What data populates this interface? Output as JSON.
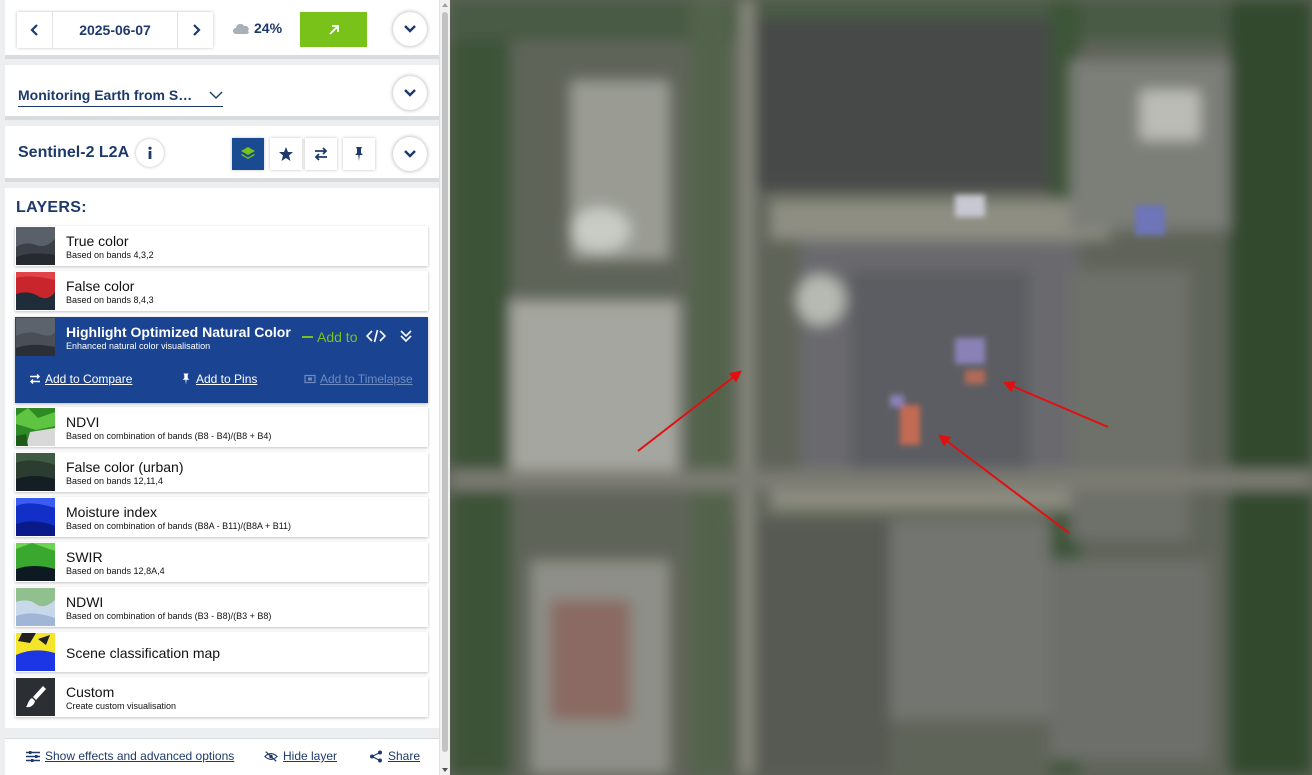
{
  "date_bar": {
    "date": "2025-06-07",
    "cloud_coverage": "24%",
    "prev_icon": "chevron-left-icon",
    "next_icon": "chevron-right-icon",
    "cloud_icon": "cloud-icon",
    "go_icon": "arrow-up-right-icon",
    "accent_color": "#78c21a"
  },
  "theme": {
    "selected": "Monitoring Earth from S…"
  },
  "dataset": {
    "title": "Sentinel-2 L2A",
    "tabs": [
      "layers-icon",
      "star-icon",
      "compare-icon",
      "pin-icon"
    ],
    "active_tab": "layers-icon",
    "brand_color": "#1a4491"
  },
  "layers": {
    "heading": "LAYERS:",
    "items": [
      {
        "title": "True color",
        "description": "Based on bands 4,3,2"
      },
      {
        "title": "False color",
        "description": "Based on bands 8,4,3"
      },
      {
        "title": "Highlight Optimized Natural Color",
        "description": "Enhanced natural color visualisation",
        "selected": true
      },
      {
        "title": "NDVI",
        "description": "Based on combination of bands (B8 - B4)/(B8 + B4)"
      },
      {
        "title": "False color (urban)",
        "description": "Based on bands 12,11,4"
      },
      {
        "title": "Moisture index",
        "description": "Based on combination of bands (B8A - B11)/(B8A + B11)"
      },
      {
        "title": "SWIR",
        "description": "Based on bands 12,8A,4"
      },
      {
        "title": "NDWI",
        "description": "Based on combination of bands (B3 - B8)/(B3 + B8)"
      },
      {
        "title": "Scene classification map",
        "description": ""
      },
      {
        "title": "Custom",
        "description": "Create custom visualisation"
      }
    ],
    "selected_actions": {
      "add_to": "Add to",
      "add_to_compare": "Add to Compare",
      "add_to_pins": "Add to Pins",
      "add_to_timelapse": "Add to Timelapse"
    }
  },
  "footer": {
    "effects": "Show effects and advanced options",
    "hide_layer": "Hide layer",
    "share": "Share"
  }
}
